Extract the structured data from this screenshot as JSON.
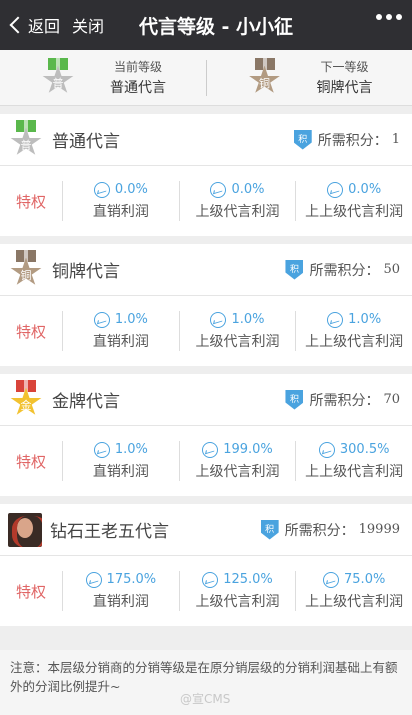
{
  "topbar": {
    "back_label": "返回",
    "close_label": "关闭",
    "title": "代言等级 - 小小征"
  },
  "levels": {
    "current": {
      "caption": "当前等级",
      "name": "普通代言",
      "medal_char": "普"
    },
    "next": {
      "caption": "下一等级",
      "name": "铜牌代言",
      "medal_char": "铜"
    }
  },
  "perk_label": "特权",
  "required_label": "所需积分：",
  "shield_char": "积",
  "stat_labels": [
    "直销利润",
    "上级代言利润",
    "上上级代言利润"
  ],
  "tiers": [
    {
      "name": "普通代言",
      "medal_char": "普",
      "points": "1",
      "values": [
        "0.0%",
        "0.0%",
        "0.0%"
      ]
    },
    {
      "name": "铜牌代言",
      "medal_char": "铜",
      "points": "50",
      "values": [
        "1.0%",
        "1.0%",
        "1.0%"
      ]
    },
    {
      "name": "金牌代言",
      "medal_char": "金",
      "points": "70",
      "values": [
        "1.0%",
        "199.0%",
        "300.5%"
      ]
    },
    {
      "name": "钻石王老五代言",
      "points": "19999",
      "values": [
        "175.0%",
        "125.0%",
        "75.0%"
      ]
    }
  ],
  "note": "注意：本层级分销商的分销等级是在原分销层级的分销利润基础上有额外的分润比例提升~",
  "watermark": "@宣CMS",
  "colors": {
    "topbar": "#2f2f33",
    "accent": "#4aa3df",
    "perk": "#e06666"
  }
}
